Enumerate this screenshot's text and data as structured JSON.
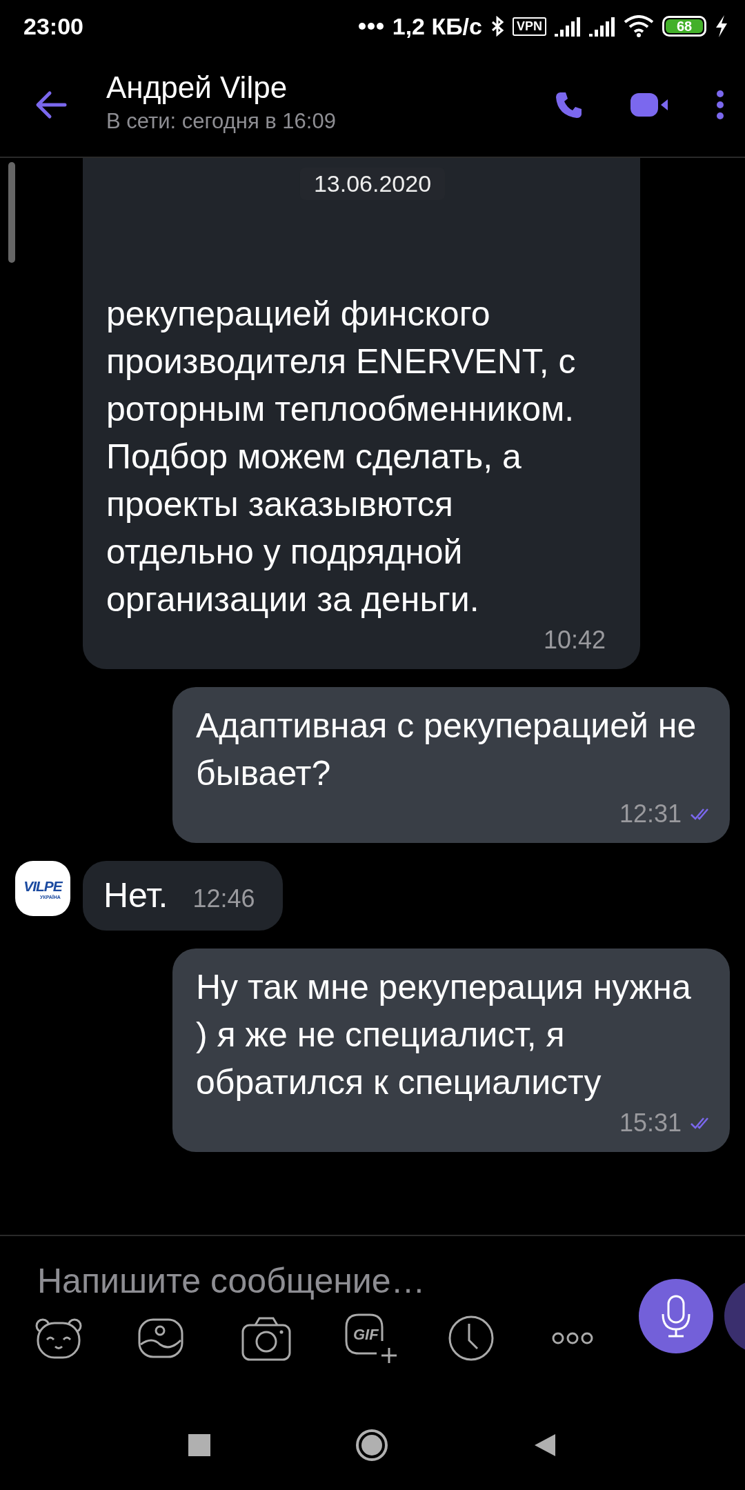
{
  "status_bar": {
    "time": "23:00",
    "network_speed": "1,2 КБ/с",
    "vpn": "VPN",
    "battery": "68",
    "charging": true
  },
  "header": {
    "title": "Андрей Vilpe",
    "subtitle": "В сети: сегодня в 16:09"
  },
  "date_label": "13.06.2020",
  "messages": [
    {
      "kind": "incoming",
      "text": "рекуперацией финского производителя ENERVENT, с роторным теплообменником. Подбор можем сделать, а проекты заказывются отдельно у подрядной организации за деньги.",
      "time": "10:42",
      "avatar": false
    },
    {
      "kind": "outgoing",
      "text": "Адаптивная с рекуперацией не бывает?",
      "time": "12:31",
      "read": true
    },
    {
      "kind": "incoming",
      "text": "Нет.",
      "time": "12:46",
      "avatar": true
    },
    {
      "kind": "outgoing",
      "text": "Ну так мне рекуперация нужна ) я же не специалист, я обратился к специалисту",
      "time": "15:31",
      "read": true
    }
  ],
  "avatar_logo": {
    "brand": "VILPE",
    "region": "УКРАЇНА"
  },
  "composer": {
    "placeholder": "Напишите сообщение…",
    "gif_label": "GIF"
  }
}
